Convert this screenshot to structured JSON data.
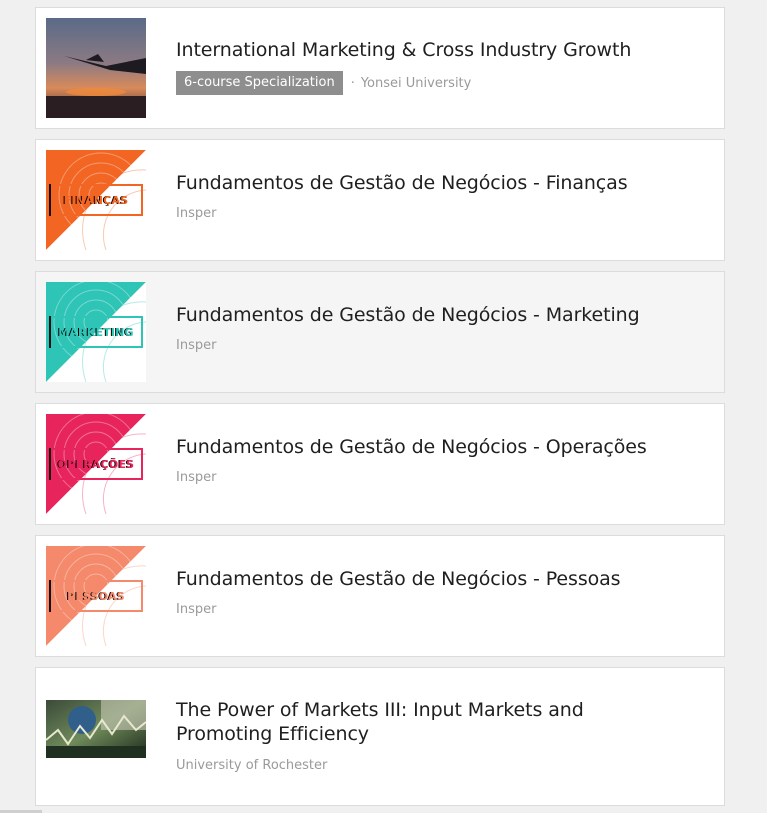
{
  "courses": [
    {
      "title": "International Marketing & Cross Industry Growth",
      "badge": "6-course Specialization",
      "partner": "Yonsei University",
      "separator": "·",
      "thumb_icon": "airplane-sunset-image"
    },
    {
      "title": "Fundamentos de Gestão de Negócios - Finanças",
      "partner": "Insper",
      "thumb_label": "FINANÇAS",
      "accent": "#f26522",
      "thumb_icon": "financas-cover-image"
    },
    {
      "title": "Fundamentos de Gestão de Negócios - Marketing",
      "partner": "Insper",
      "thumb_label": "MARKETING",
      "accent": "#2ec4b6",
      "thumb_icon": "marketing-cover-image"
    },
    {
      "title": "Fundamentos de Gestão de Negócios - Operações",
      "partner": "Insper",
      "thumb_label": "OPERAÇÕES",
      "accent": "#e8245c",
      "thumb_icon": "operacoes-cover-image"
    },
    {
      "title": "Fundamentos de Gestão de Negócios - Pessoas",
      "partner": "Insper",
      "thumb_label": "PESSOAS",
      "accent": "#f4896b",
      "thumb_icon": "pessoas-cover-image"
    },
    {
      "title_line1": "The Power of Markets III: Input Markets and",
      "title_line2": "Promoting Efficiency",
      "partner": "University of Rochester",
      "thumb_icon": "market-chart-image"
    }
  ]
}
